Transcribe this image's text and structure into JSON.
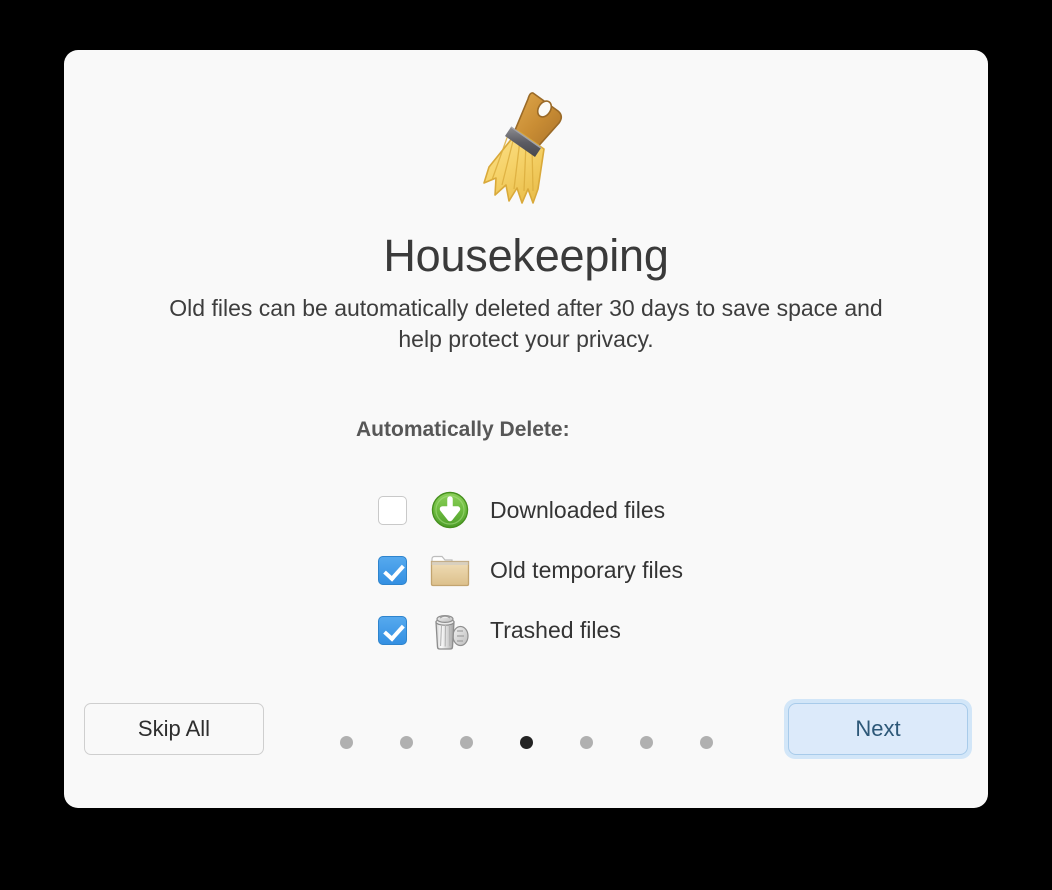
{
  "window": {
    "backdrop_color": "#000000",
    "card_color": "#f9f9f9"
  },
  "hero": {
    "icon": "broom-icon"
  },
  "header": {
    "title": "Housekeeping",
    "subtitle": "Old files can be automatically deleted after 30 days to save space and help protect your privacy."
  },
  "options": {
    "heading": "Automatically Delete:",
    "items": [
      {
        "label": "Downloaded files",
        "checked": false,
        "icon": "download-icon",
        "icon_color": "#62b945"
      },
      {
        "label": "Old temporary files",
        "checked": true,
        "icon": "folder-icon",
        "icon_color": "#e6cfa0"
      },
      {
        "label": "Trashed files",
        "checked": true,
        "icon": "trash-icon",
        "icon_color": "#c8c8c8"
      }
    ]
  },
  "footer": {
    "skip_label": "Skip All",
    "next_label": "Next",
    "accent_color": "#3d9ae8",
    "pagination": {
      "total": 7,
      "active_index": 3
    }
  }
}
